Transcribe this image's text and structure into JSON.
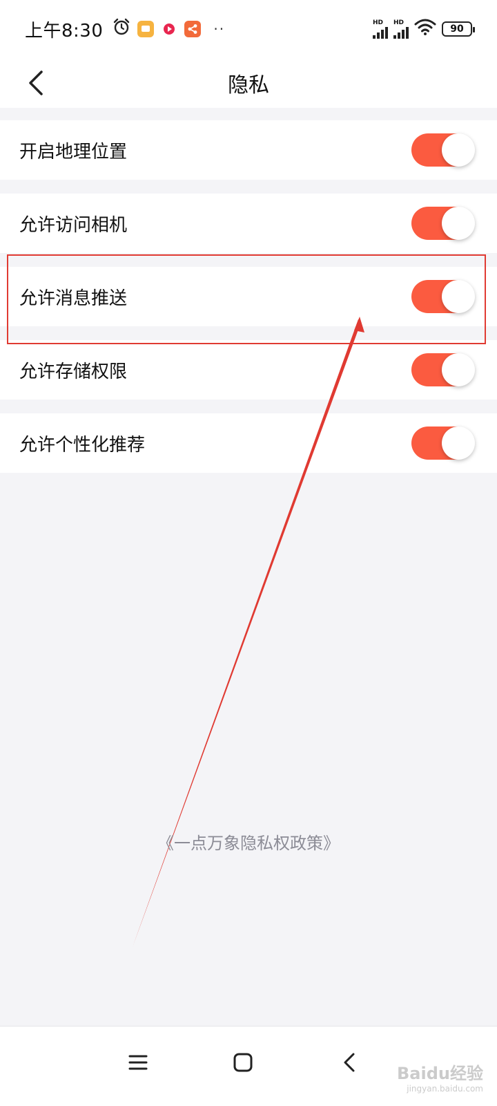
{
  "status_bar": {
    "time": "上午8:30",
    "battery": "90",
    "network_tag": "HD",
    "more_indicator": "··",
    "icons": [
      "alarm-icon",
      "notes-app-icon",
      "video-app-icon",
      "share-app-icon",
      "signal-icon",
      "wifi-icon",
      "battery-icon"
    ]
  },
  "header": {
    "title": "隐私",
    "back_icon": "chevron-left-icon"
  },
  "settings": [
    {
      "label": "开启地理位置",
      "enabled": true
    },
    {
      "label": "允许访问相机",
      "enabled": true
    },
    {
      "label": "允许消息推送",
      "enabled": true
    },
    {
      "label": "允许存储权限",
      "enabled": true
    },
    {
      "label": "允许个性化推荐",
      "enabled": true
    }
  ],
  "policy_link": "《一点万象隐私权政策》",
  "nav_bar": {
    "icons": [
      "menu-icon",
      "home-icon",
      "back-icon"
    ]
  },
  "watermark": {
    "main": "Baidu经验",
    "sub": "jingyan.baidu.com"
  },
  "colors": {
    "toggle_on": "#fb5b40",
    "annotation": "#e03a32",
    "background": "#f4f4f7"
  }
}
